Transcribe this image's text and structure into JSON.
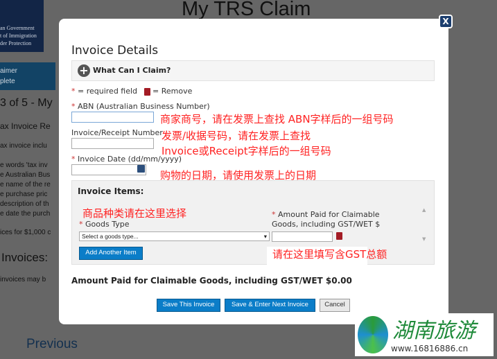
{
  "background": {
    "logo": {
      "line1": "an Government",
      "line2": "t of Immigration",
      "line3": "der Protection"
    },
    "app_title": "My TRS Claim",
    "step": {
      "line1": "aimer",
      "line2": "plete"
    },
    "step_heading": "3 of 5 - My",
    "section": "ax Invoice Re",
    "lines": [
      "ax invoice inclu",
      "e words 'tax inv",
      "e Australian Bus",
      "e name of the re",
      "e purchase pric",
      "description of th",
      "e date the purch",
      "ices for $1,000 c"
    ],
    "invoices_heading": "Invoices:",
    "invoices_note": "invoices may b",
    "previous": "Previous"
  },
  "modal": {
    "close_label": "X",
    "title": "Invoice Details",
    "what_can_i_claim": "What Can I Claim?",
    "legend": {
      "star": "*",
      "required": "= required field",
      "remove": "= Remove"
    },
    "abn": {
      "label": "ABN (Australian Business Number)",
      "value": ""
    },
    "invoice_number": {
      "label": "Invoice/Receipt Number",
      "value": ""
    },
    "invoice_date": {
      "label": "Invoice Date (dd/mm/yyyy)",
      "value": ""
    },
    "items": {
      "heading": "Invoice Items:",
      "goods_type_label": "Goods Type",
      "goods_type_placeholder": "Select a goods type...",
      "amount_label_1": "Amount Paid for Claimable",
      "amount_label_2": "Goods, including GST/WET $",
      "add_button": "Add Another Item"
    },
    "total": "Amount Paid for Claimable Goods, including GST/WET $0.00",
    "buttons": {
      "save": "Save This Invoice",
      "save_next": "Save & Enter Next Invoice",
      "cancel": "Cancel"
    }
  },
  "annotations": {
    "abn": "商家商号，请在发票上查找 ABN字样后的一组号码",
    "invoice1": "发票/收据号码，请在发票上查找",
    "invoice2": "Invoice或Receipt字样后的一组号码",
    "date": "购物的日期，请使用发票上的日期",
    "goods": "商品种类请在这里选择",
    "amount": "请在这里填写含GST总额"
  },
  "watermark": {
    "text": "湖南旅游",
    "url": "www.16816886.cn"
  },
  "colors": {
    "accent": "#0b7dc8",
    "annotation": "#ff2222",
    "required": "#cc3333"
  }
}
